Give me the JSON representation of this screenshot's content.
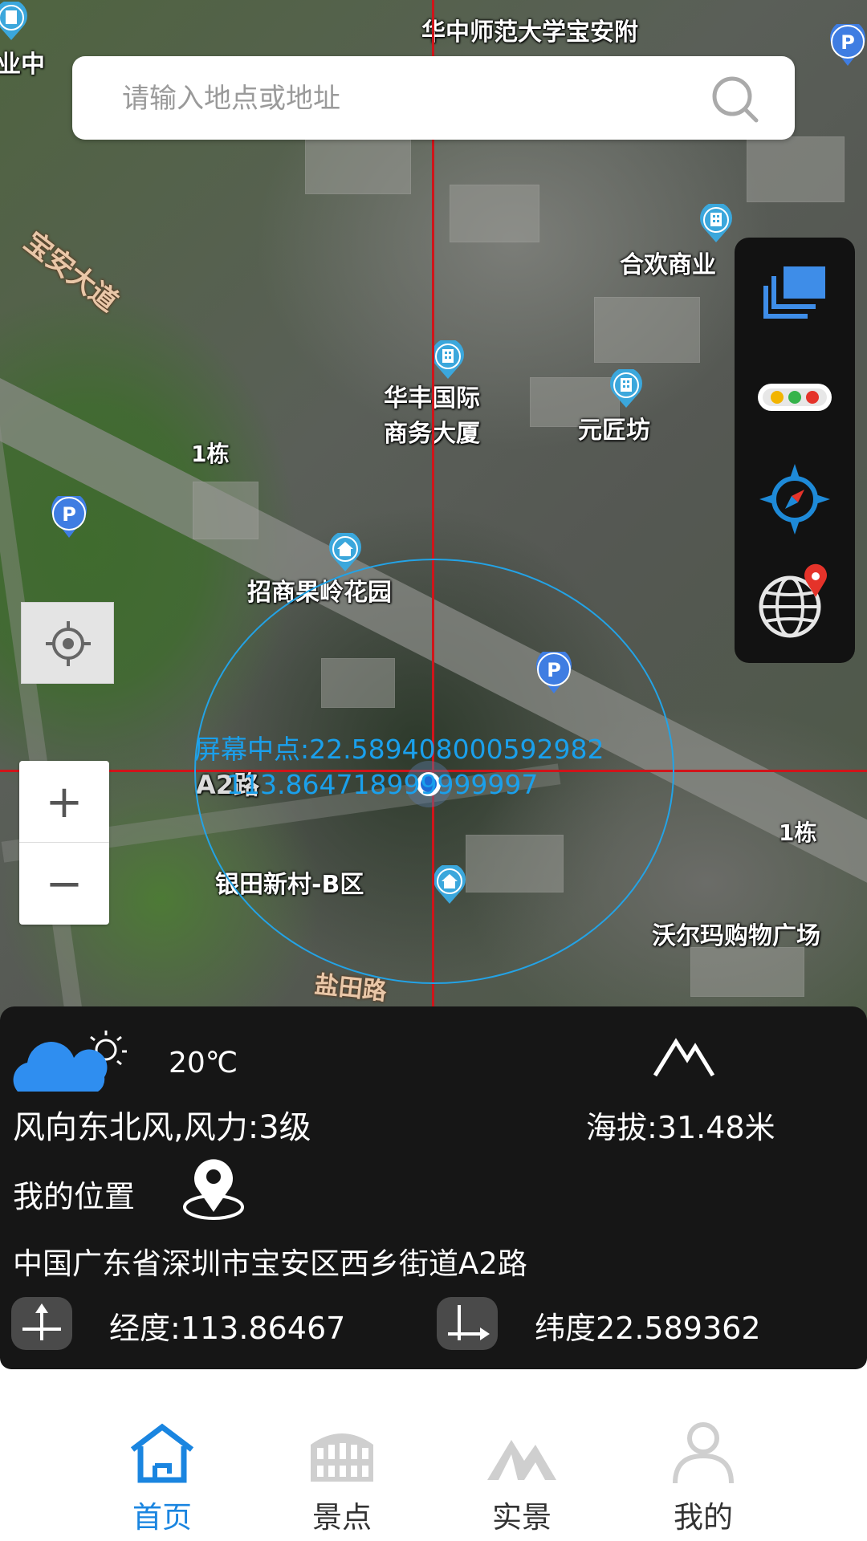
{
  "search": {
    "placeholder": "请输入地点或地址"
  },
  "map": {
    "labels": {
      "huazhong": "华中师范大学宝安附",
      "ye_zhong": "业中",
      "hehuan": "合欢商业",
      "huafeng_1": "华丰国际",
      "huafeng_2": "商务大厦",
      "yuanjiangfang": "元匠坊",
      "dong1_a": "1栋",
      "dong1_b": "1栋",
      "zhaoshang": "招商果岭花园",
      "yintian": "银田新村-B区",
      "walmart": "沃尔玛购物广场",
      "baoan_road": "宝安大道",
      "yantian_road": "盐田路",
      "a2_road": "A2路"
    },
    "center_text": {
      "line1": "屏幕中点:22.589408000592982",
      "line2": "113.864718999999997"
    },
    "crosshair_color": "#d0141a",
    "circle_color": "#23a3e6"
  },
  "sidebar": {
    "icons": [
      "layers-icon",
      "traffic-light-icon",
      "compass-icon",
      "globe-pin-icon"
    ]
  },
  "zoom": {
    "plus": "+",
    "minus": "−"
  },
  "panel": {
    "temperature": "20℃",
    "wind": "风向东北风,风力:3级",
    "altitude": "海拔:31.48米",
    "my_location": "我的位置",
    "address": "中国广东省深圳市宝安区西乡街道A2路",
    "longitude": "经度:113.86467",
    "latitude": "纬度22.589362"
  },
  "nav": {
    "items": [
      {
        "label": "首页",
        "icon": "home-icon",
        "active": true
      },
      {
        "label": "景点",
        "icon": "landmark-icon",
        "active": false
      },
      {
        "label": "实景",
        "icon": "mountain-icon",
        "active": false
      },
      {
        "label": "我的",
        "icon": "user-icon",
        "active": false
      }
    ],
    "active_color": "#1a85e0"
  }
}
